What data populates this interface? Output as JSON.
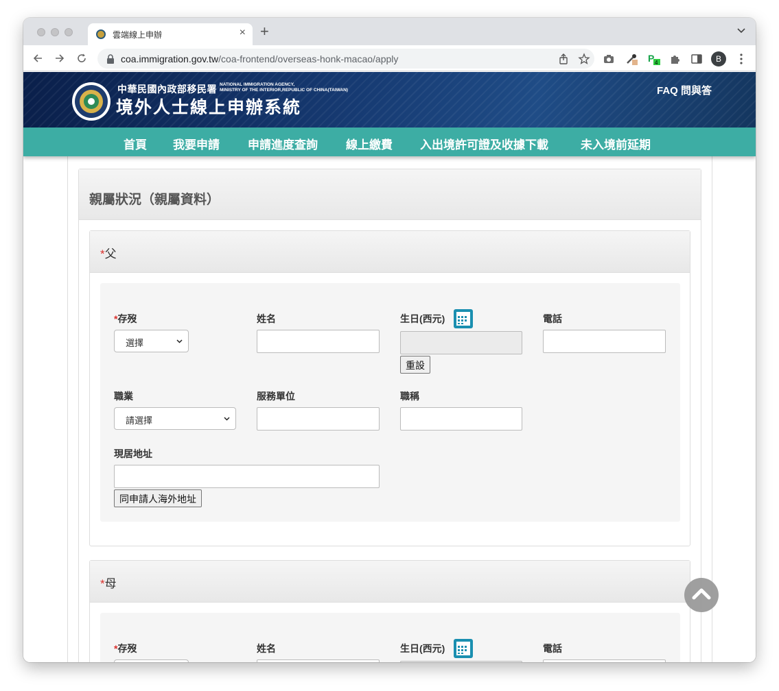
{
  "browser": {
    "tab_title": "雲端線上申辦",
    "url_host": "coa.immigration.gov.tw",
    "url_path": "/coa-frontend/overseas-honk-macao/apply",
    "profile_initial": "B",
    "extension_badge": "4"
  },
  "site": {
    "agency_cn": "中華民國內政部移民署",
    "agency_en_line1": "NATIONAL IMMIGRATION AGENCY,",
    "agency_en_line2": "MINISTRY OF THE INTERIOR,REPUBLIC OF CHINA(TAIWAN)",
    "title": "境外人士線上申辦系統",
    "faq": "FAQ 問與答"
  },
  "nav": {
    "home": "首頁",
    "apply": "我要申請",
    "progress": "申請進度查詢",
    "payment": "線上繳費",
    "permit_download": "入出境許可證及收據下載",
    "extension": "未入境前延期"
  },
  "section": {
    "title": "親屬狀況（親屬資料）"
  },
  "father": {
    "required_mark": "*",
    "title": "父",
    "status_label": "存歿",
    "status_value": "選擇",
    "name_label": "姓名",
    "birth_label": "生日(西元)",
    "reset_button": "重設",
    "phone_label": "電話",
    "occupation_label": "職業",
    "occupation_value": "請選擇",
    "employer_label": "服務單位",
    "job_title_label": "職稱",
    "address_label": "現居地址",
    "same_address_button": "同申請人海外地址"
  },
  "mother": {
    "required_mark": "*",
    "title": "母",
    "status_label": "存歿",
    "name_label": "姓名",
    "birth_label": "生日(西元)",
    "phone_label": "電話"
  },
  "colors": {
    "header_navy": "#163a72",
    "nav_teal": "#3dada4",
    "required_red": "#d9302c",
    "calendar_blue": "#1a8fb0"
  }
}
